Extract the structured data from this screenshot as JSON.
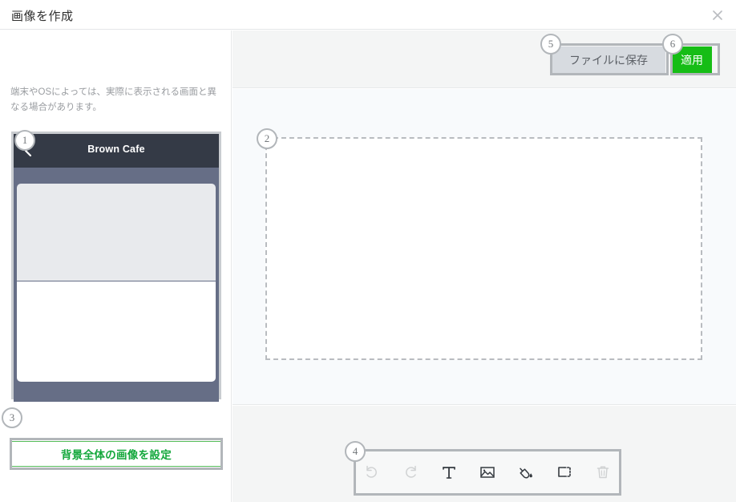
{
  "window": {
    "title": "画像を作成",
    "close_icon": "close-icon"
  },
  "left_panel": {
    "note": "端末やOSによっては、実際に表示される画面と異なる場合があります。",
    "phone_preview": {
      "back_icon": "chevron-left-icon",
      "header_title": "Brown Cafe"
    },
    "background_button": {
      "label": "背景全体の画像を設定"
    }
  },
  "action_bar": {
    "save_button": "ファイルに保存",
    "apply_button": "適用"
  },
  "canvas": {
    "name": "image-canvas"
  },
  "toolbar": {
    "tools": [
      {
        "name": "undo-icon",
        "label": "元に戻す",
        "disabled": true
      },
      {
        "name": "redo-icon",
        "label": "やり直す",
        "disabled": true
      },
      {
        "name": "text-icon",
        "label": "テキスト",
        "disabled": false
      },
      {
        "name": "image-icon",
        "label": "画像",
        "disabled": false
      },
      {
        "name": "fill-icon",
        "label": "塗りつぶし",
        "disabled": false
      },
      {
        "name": "select-area-icon",
        "label": "範囲選択",
        "disabled": false
      },
      {
        "name": "trash-icon",
        "label": "削除",
        "disabled": true
      }
    ]
  },
  "callouts": {
    "one": "1",
    "two": "2",
    "three": "3",
    "four": "4",
    "five": "5",
    "six": "6"
  },
  "colors": {
    "accent_green": "#16bd16",
    "link_green": "#14a83c",
    "phone_header": "#343a46",
    "phone_band": "#666e86",
    "save_gray": "#d7dbe0",
    "callout_border": "#b2b6ba"
  }
}
